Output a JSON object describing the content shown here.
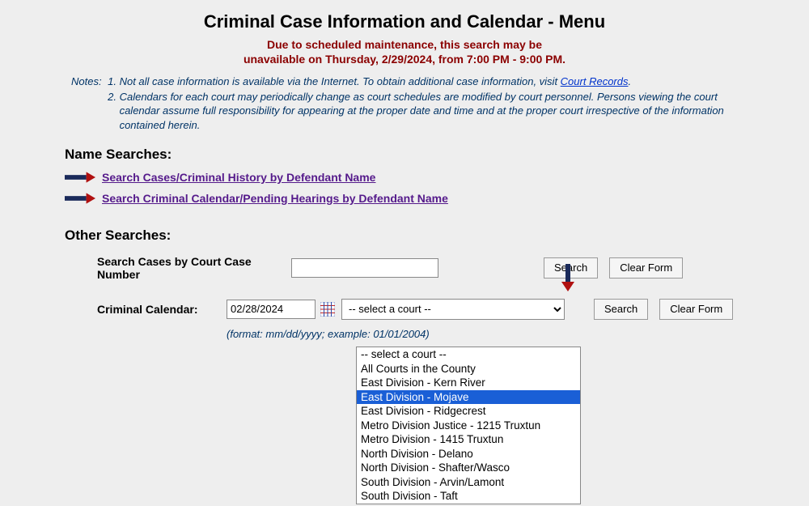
{
  "title": "Criminal Case Information and Calendar - Menu",
  "maintenance": {
    "line1": "Due to scheduled maintenance, this search may be",
    "line2": "unavailable on Thursday, 2/29/2024, from 7:00 PM - 9:00 PM."
  },
  "notes": {
    "label": "Notes:",
    "items": [
      {
        "pre": "Not all case information is available via the Internet. To obtain additional case information, visit ",
        "link": "Court Records",
        "post": "."
      },
      {
        "pre": "Calendars for each court may periodically change as court schedules are modified by court personnel. Persons viewing the court calendar assume full responsibility for appearing at the proper date and time and at the proper court irrespective of the information contained herein.",
        "link": "",
        "post": ""
      }
    ]
  },
  "sections": {
    "name_searches_heading": "Name Searches:",
    "other_searches_heading": "Other Searches:"
  },
  "name_links": [
    "Search Cases/Criminal History by Defendant Name",
    "Search Criminal Calendar/Pending Hearings by Defendant Name"
  ],
  "case_number": {
    "label": "Search Cases by Court Case Number",
    "value": "",
    "search_btn": "Search",
    "clear_btn": "Clear Form"
  },
  "calendar": {
    "label": "Criminal Calendar:",
    "date": "02/28/2024",
    "select_placeholder": "-- select a court --",
    "search_btn": "Search",
    "clear_btn": "Clear Form",
    "format_hint": "(format: mm/dd/yyyy; example: 01/01/2004)"
  },
  "court_options": [
    "-- select a court --",
    "All Courts in the County",
    "East Division - Kern River",
    "East Division - Mojave",
    "East Division - Ridgecrest",
    "Metro Division Justice - 1215 Truxtun",
    "Metro Division - 1415 Truxtun",
    "North Division - Delano",
    "North Division - Shafter/Wasco",
    "South Division - Arvin/Lamont",
    "South Division - Taft"
  ],
  "selected_court_index": 3
}
